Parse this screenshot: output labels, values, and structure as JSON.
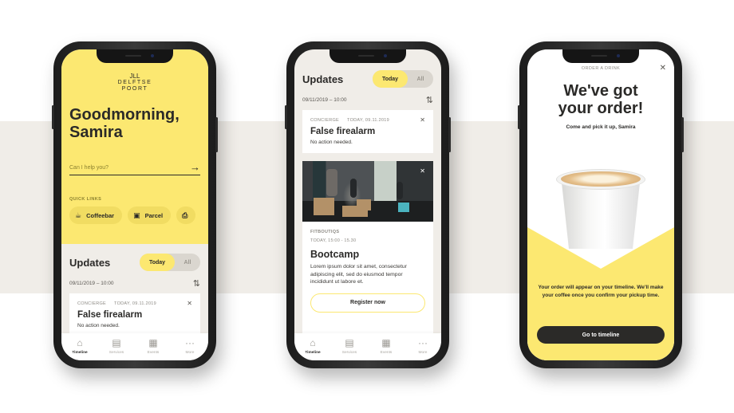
{
  "colors": {
    "brand_yellow": "#fce871",
    "chip_yellow": "#f1dc62",
    "dark": "#2b2a28",
    "surface": "#f0ede8"
  },
  "logo": {
    "mark": "JᒪL",
    "line1": "DELFTSE",
    "line2": "POORT"
  },
  "home": {
    "greeting_line1": "Goodmorning,",
    "greeting_line2": "Samira",
    "ask_placeholder": "Can I help you?",
    "ask_icon": "arrow-right-icon",
    "quick_links_title": "QUICK LINKS",
    "quick_links": [
      {
        "label": "Coffeebar",
        "icon": "coffee-cup-icon"
      },
      {
        "label": "Parcel",
        "icon": "parcel-icon"
      },
      {
        "label": "",
        "icon": "printer-icon"
      }
    ]
  },
  "updates": {
    "title": "Updates",
    "toggle": {
      "active": "Today",
      "inactive": "All"
    },
    "timestamp": "09/11/2019 – 10:00",
    "refresh_icon": "refresh-icon",
    "alert_card": {
      "category": "CONCIERGE",
      "date": "TODAY, 09.11.2019",
      "title": "False firealarm",
      "body": "No action needed."
    },
    "event_card": {
      "organizer": "FITBOUTIQS",
      "time": "TODAY, 15:00 - 15.30",
      "title": "Bootcamp",
      "body": "Lorem ipsum dolor sit amet, consectetur adipiscing elit, sed do eiusmod tempor incididunt ut labore et.",
      "button": "Register now"
    }
  },
  "tabbar": [
    {
      "label": "Timeline",
      "icon": "home-icon",
      "active": true
    },
    {
      "label": "Services",
      "icon": "services-icon",
      "active": false
    },
    {
      "label": "Events",
      "icon": "calendar-icon",
      "active": false
    },
    {
      "label": "More",
      "icon": "more-icon",
      "active": false
    }
  ],
  "order": {
    "header": "ORDER A DRINK",
    "title_line1": "We've got",
    "title_line2": "your order!",
    "subtitle": "Come and pick it up, Samira",
    "message": "Your order will appear on your timeline. We'll make your coffee once you confirm your pickup time.",
    "button": "Go to timeline"
  }
}
